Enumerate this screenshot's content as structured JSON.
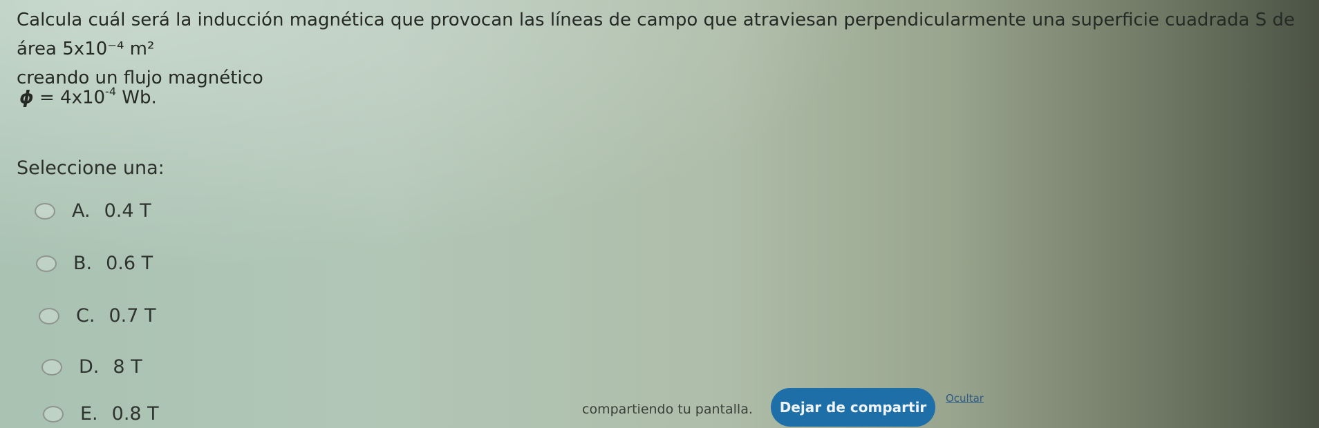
{
  "question": {
    "text_line1": "Calcula cuál será la inducción magnética que provocan las líneas de campo que atraviesan perpendicularmente una superficie cuadrada S de área 5x10⁻⁴ m²",
    "text_line2": "creando un flujo magnético",
    "formula_prefix": "ϕ",
    "formula_equals": " = 4x10",
    "formula_exponent": "-4",
    "formula_unit": " Wb."
  },
  "prompt": "Seleccione una:",
  "options": [
    {
      "letter": "A.",
      "value": "0.4 T"
    },
    {
      "letter": "B.",
      "value": "0.6 T"
    },
    {
      "letter": "C.",
      "value": "0.7 T"
    },
    {
      "letter": "D.",
      "value": "8 T"
    },
    {
      "letter": "E.",
      "value": "0.8 T"
    }
  ],
  "share_bar": {
    "status_text": "compartiendo tu pantalla.",
    "stop_button": "Dejar de compartir",
    "hide_link": "Ocultar"
  }
}
